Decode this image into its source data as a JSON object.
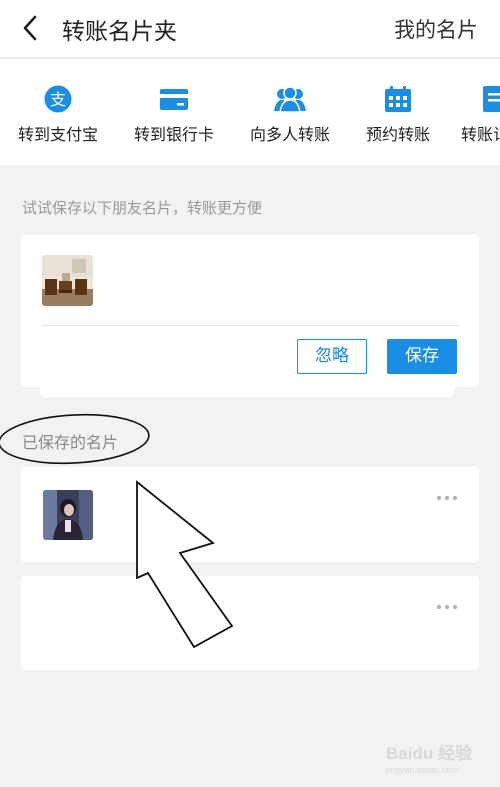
{
  "header": {
    "title": "转账名片夹",
    "my_card": "我的名片",
    "back_icon": "chevron-left-icon"
  },
  "quick_actions": [
    {
      "label": "转到支付宝",
      "icon": "alipay-icon"
    },
    {
      "label": "转到银行卡",
      "icon": "bank-card-icon"
    },
    {
      "label": "向多人转账",
      "icon": "users-icon"
    },
    {
      "label": "预约转账",
      "icon": "calendar-icon"
    },
    {
      "label": "转账记",
      "icon": "record-icon"
    }
  ],
  "suggest": {
    "hint": "试试保存以下朋友名片，转账更方便",
    "ignore_label": "忽略",
    "save_label": "保存"
  },
  "saved": {
    "label": "已保存的名片"
  },
  "watermark": {
    "brand": "Baidu 经验",
    "url": "jingyan.baidu.com"
  },
  "colors": {
    "accent": "#1a8de5",
    "background": "#f2f2f2"
  }
}
